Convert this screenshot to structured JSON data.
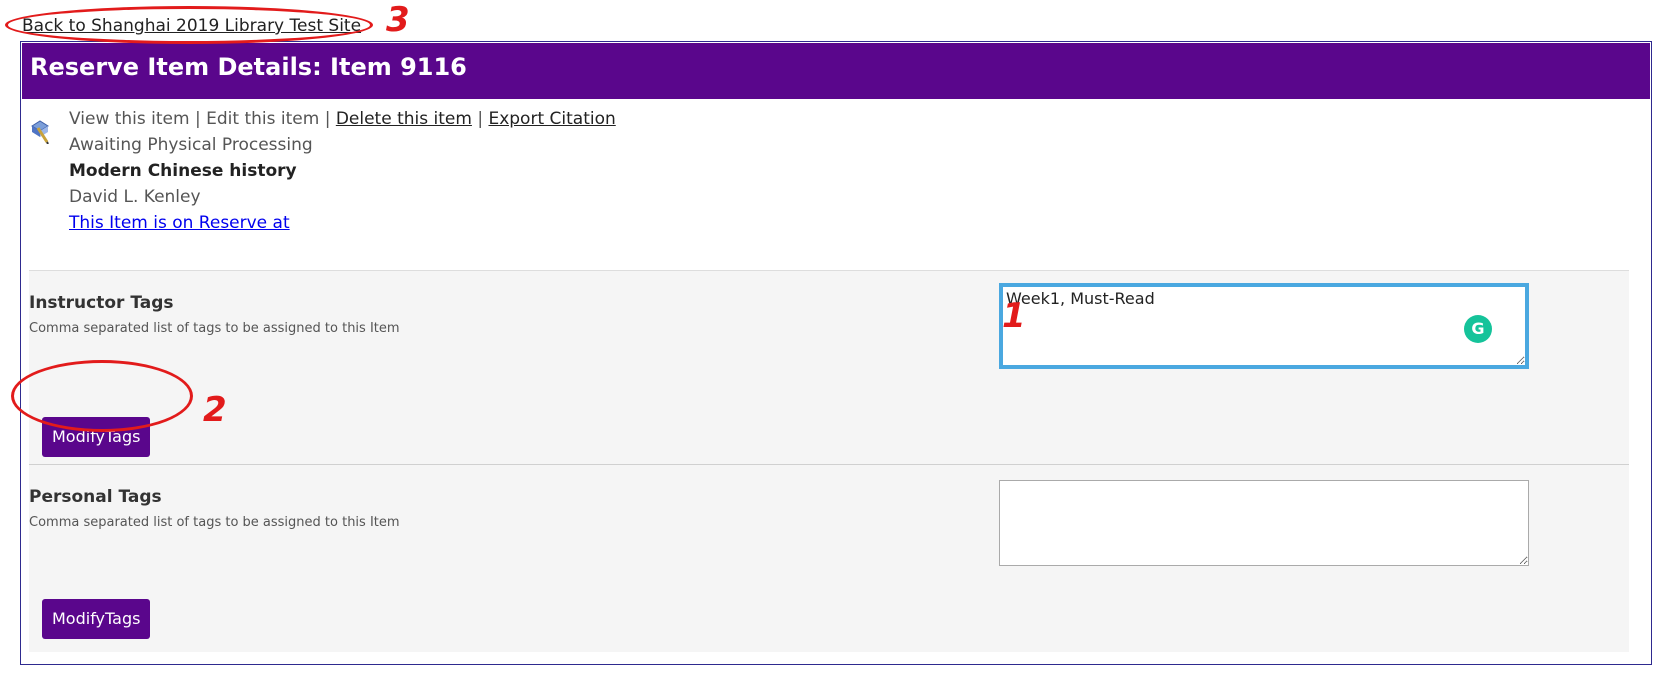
{
  "back_link": "Back to Shanghai 2019 Library Test Site",
  "header": {
    "title": "Reserve Item Details: Item 9116"
  },
  "item": {
    "icon": "book-pencil-icon",
    "actions": {
      "view": "View this item",
      "edit": "Edit this item",
      "delete": "Delete this item",
      "export": "Export Citation",
      "separator": "|"
    },
    "status": "Awaiting Physical Processing",
    "title": "Modern Chinese history",
    "author": "David L. Kenley",
    "reserve_link": "This Item is on Reserve at"
  },
  "instructor_tags": {
    "label": "Instructor Tags",
    "help": "Comma separated list of tags to be assigned to this Item",
    "value": "Week1, Must-Read",
    "button": "ModifyTags"
  },
  "personal_tags": {
    "label": "Personal Tags",
    "help": "Comma separated list of tags to be assigned to this Item",
    "value": "",
    "button": "ModifyTags"
  },
  "annotations": {
    "a1": "1",
    "a2": "2",
    "a3": "3",
    "color": "#e21b1b"
  },
  "colors": {
    "brand": "#5a068c",
    "focus": "#4aa8e0",
    "grammarly": "#15c39a"
  }
}
